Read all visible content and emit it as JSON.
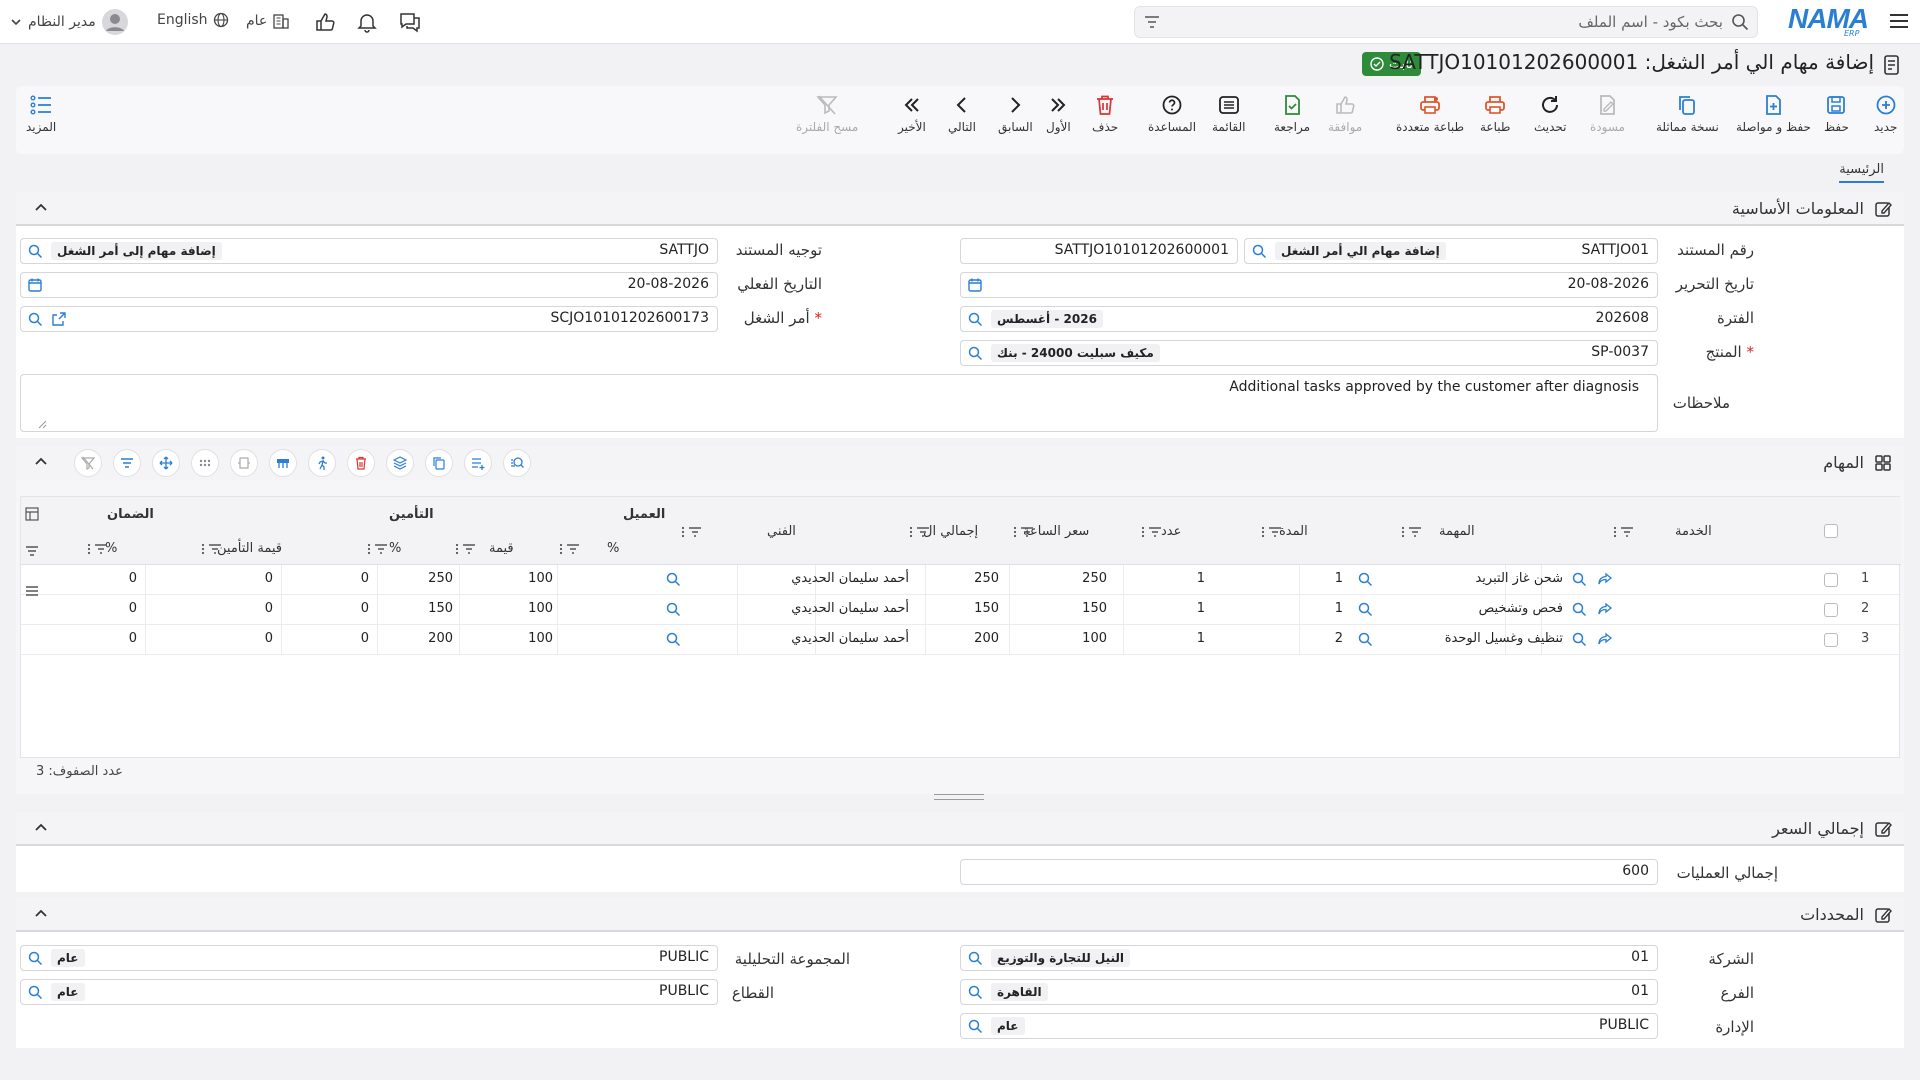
{
  "topbar": {
    "search_placeholder": "بحث بكود - اسم الملف",
    "logo": "NAMA",
    "logo_sub": "ERP",
    "language": "English",
    "public_label": "عام",
    "user_name": "مدير النظام"
  },
  "page": {
    "title": "إضافة مهام الي أمر الشغل: SATTJO10101202600001",
    "status_badge": "ثابت"
  },
  "toolbar": {
    "buttons": [
      {
        "label": "جديد",
        "icon": "plus-circle-icon"
      },
      {
        "label": "حفظ",
        "icon": "save-icon"
      },
      {
        "label": "حفظ و مواصلة",
        "icon": "save-continue-icon"
      },
      {
        "label": "نسخة مماثلة",
        "icon": "copy-icon"
      },
      {
        "label": "مسودة",
        "icon": "draft-icon"
      },
      {
        "label": "تحديث",
        "icon": "refresh-icon"
      },
      {
        "label": "طباعة",
        "icon": "print-icon"
      },
      {
        "label": "طباعة متعددة",
        "icon": "multi-print-icon"
      },
      {
        "label": "موافقة",
        "icon": "thumbs-up-icon"
      },
      {
        "label": "مراجعة",
        "icon": "review-icon"
      },
      {
        "label": "القائمة",
        "icon": "list-icon"
      },
      {
        "label": "المساعدة",
        "icon": "help-icon"
      },
      {
        "label": "حذف",
        "icon": "trash-icon"
      },
      {
        "label": "الأول",
        "icon": "first-icon"
      },
      {
        "label": "السابق",
        "icon": "prev-icon"
      },
      {
        "label": "التالي",
        "icon": "next-icon"
      },
      {
        "label": "الأخير",
        "icon": "last-icon"
      },
      {
        "label": "مسح الفلترة",
        "icon": "clear-filter-icon"
      }
    ],
    "more_label": "المزيد"
  },
  "tabs": {
    "main": "الرئيسية"
  },
  "basic_info": {
    "title": "المعلومات الأساسية",
    "doc_no_label": "رقم المستند",
    "doc_no_code": "SATTJO01",
    "doc_no_name": "إضافة مهام الي أمر الشغل",
    "doc_no_value": "SATTJO10101202600001",
    "doc_route_label": "توجيه المستند",
    "doc_route_code": "SATTJO",
    "doc_route_name": "إضافة مهام إلى أمر الشغل",
    "edit_date_label": "تاريخ التحرير",
    "edit_date": "20-08-2026",
    "actual_date_label": "التاريخ الفعلي",
    "actual_date": "20-08-2026",
    "period_label": "الفترة",
    "period_code": "202608",
    "period_name": "2026 - أغسطس",
    "job_order_label": "أمر الشغل",
    "job_order": "SCJO10101202600173",
    "product_label": "المنتج",
    "product_code": "SP-0037",
    "product_name": "مكيف سبليت 24000 - بنك",
    "notes_label": "ملاحظات",
    "notes": "Additional tasks approved by the customer after diagnosis"
  },
  "tasks": {
    "title": "المهام",
    "group_headers": {
      "customer": "العميل",
      "insurance": "التأمين",
      "warranty": "الضمان"
    },
    "columns": {
      "service": "الخدمة",
      "task": "المهمة",
      "duration": "المدة",
      "count": "عدد",
      "hour_price": "سعر الساعة",
      "total": "إجمالي ال",
      "technician": "الفني",
      "cust_pct": "%",
      "cust_value": "قيمة",
      "ins_pct": "%",
      "ins_value": "قيمة التأمين",
      "war_pct": "%"
    },
    "rows": [
      {
        "no": "1",
        "task": "شحن غاز التبريد",
        "duration": "1",
        "count": "1",
        "hour_price": "250",
        "total": "250",
        "technician": "أحمد سليمان الحديدي",
        "cust_pct": "100",
        "cust_value": "250",
        "ins_pct": "0",
        "ins_value": "0",
        "war_pct": "0"
      },
      {
        "no": "2",
        "task": "فحص وتشخيص",
        "duration": "1",
        "count": "1",
        "hour_price": "150",
        "total": "150",
        "technician": "أحمد سليمان الحديدي",
        "cust_pct": "100",
        "cust_value": "150",
        "ins_pct": "0",
        "ins_value": "0",
        "war_pct": "0"
      },
      {
        "no": "3",
        "task": "تنظيف وغسيل الوحدة",
        "duration": "2",
        "count": "1",
        "hour_price": "100",
        "total": "200",
        "technician": "أحمد سليمان الحديدي",
        "cust_pct": "100",
        "cust_value": "200",
        "ins_pct": "0",
        "ins_value": "0",
        "war_pct": "0"
      }
    ],
    "row_count_label": "عدد الصفوف: 3"
  },
  "price_total": {
    "title": "إجمالي السعر",
    "ops_total_label": "إجمالي العمليات",
    "ops_total": "600"
  },
  "dimensions": {
    "title": "المحددات",
    "company_label": "الشركة",
    "company_code": "01",
    "company_name": "النيل للتجارة والتوزيع",
    "branch_label": "الفرع",
    "branch_code": "01",
    "branch_name": "القاهرة",
    "dept_label": "الإدارة",
    "dept_code": "PUBLIC",
    "dept_name": "عام",
    "analytic_label": "المجموعة التحليلية",
    "analytic_code": "PUBLIC",
    "analytic_name": "عام",
    "sector_label": "القطاع",
    "sector_code": "PUBLIC",
    "sector_name": "عام"
  }
}
